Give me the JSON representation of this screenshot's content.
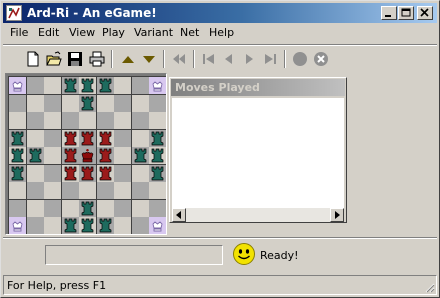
{
  "window": {
    "title": "Ard-Ri - An eGame!"
  },
  "menu": [
    "File",
    "Edit",
    "View",
    "Play",
    "Variant",
    "Net",
    "Help"
  ],
  "toolbar": {
    "groups": [
      [
        "new-file-icon",
        "open-folder-icon",
        "save-disk-icon",
        "print-icon"
      ],
      [
        "triangle-up-icon",
        "triangle-down-icon"
      ],
      [
        "rewind-to-start-icon"
      ],
      [
        "step-first-icon",
        "step-back-icon",
        "step-forward-icon",
        "step-last-icon"
      ],
      [
        "stop-circle-icon",
        "cancel-circle-icon"
      ]
    ]
  },
  "board": {
    "size": 9,
    "colors": {
      "light": "#d4d0c8",
      "dark": "#a8a8a8",
      "corner": "#d8c8f0",
      "attacker": "#1e6b5e",
      "defender": "#9b1b1b",
      "king": "#8b0a0a"
    },
    "corners": [
      [
        0,
        0
      ],
      [
        0,
        8
      ],
      [
        8,
        0
      ],
      [
        8,
        8
      ]
    ],
    "pieces": [
      {
        "r": 0,
        "c": 3,
        "t": "attacker"
      },
      {
        "r": 0,
        "c": 4,
        "t": "attacker"
      },
      {
        "r": 0,
        "c": 5,
        "t": "attacker"
      },
      {
        "r": 1,
        "c": 4,
        "t": "attacker"
      },
      {
        "r": 3,
        "c": 0,
        "t": "attacker"
      },
      {
        "r": 4,
        "c": 0,
        "t": "attacker"
      },
      {
        "r": 5,
        "c": 0,
        "t": "attacker"
      },
      {
        "r": 4,
        "c": 1,
        "t": "attacker"
      },
      {
        "r": 3,
        "c": 8,
        "t": "attacker"
      },
      {
        "r": 4,
        "c": 8,
        "t": "attacker"
      },
      {
        "r": 5,
        "c": 8,
        "t": "attacker"
      },
      {
        "r": 4,
        "c": 7,
        "t": "attacker"
      },
      {
        "r": 8,
        "c": 3,
        "t": "attacker"
      },
      {
        "r": 8,
        "c": 4,
        "t": "attacker"
      },
      {
        "r": 8,
        "c": 5,
        "t": "attacker"
      },
      {
        "r": 7,
        "c": 4,
        "t": "attacker"
      },
      {
        "r": 3,
        "c": 3,
        "t": "defender"
      },
      {
        "r": 3,
        "c": 4,
        "t": "defender"
      },
      {
        "r": 3,
        "c": 5,
        "t": "defender"
      },
      {
        "r": 4,
        "c": 3,
        "t": "defender"
      },
      {
        "r": 4,
        "c": 4,
        "t": "king"
      },
      {
        "r": 4,
        "c": 5,
        "t": "defender"
      },
      {
        "r": 5,
        "c": 3,
        "t": "defender"
      },
      {
        "r": 5,
        "c": 4,
        "t": "defender"
      },
      {
        "r": 5,
        "c": 5,
        "t": "defender"
      }
    ]
  },
  "moves_panel": {
    "title": "Moves Played"
  },
  "status": {
    "ready": "Ready!",
    "help": "For Help, press F1"
  }
}
